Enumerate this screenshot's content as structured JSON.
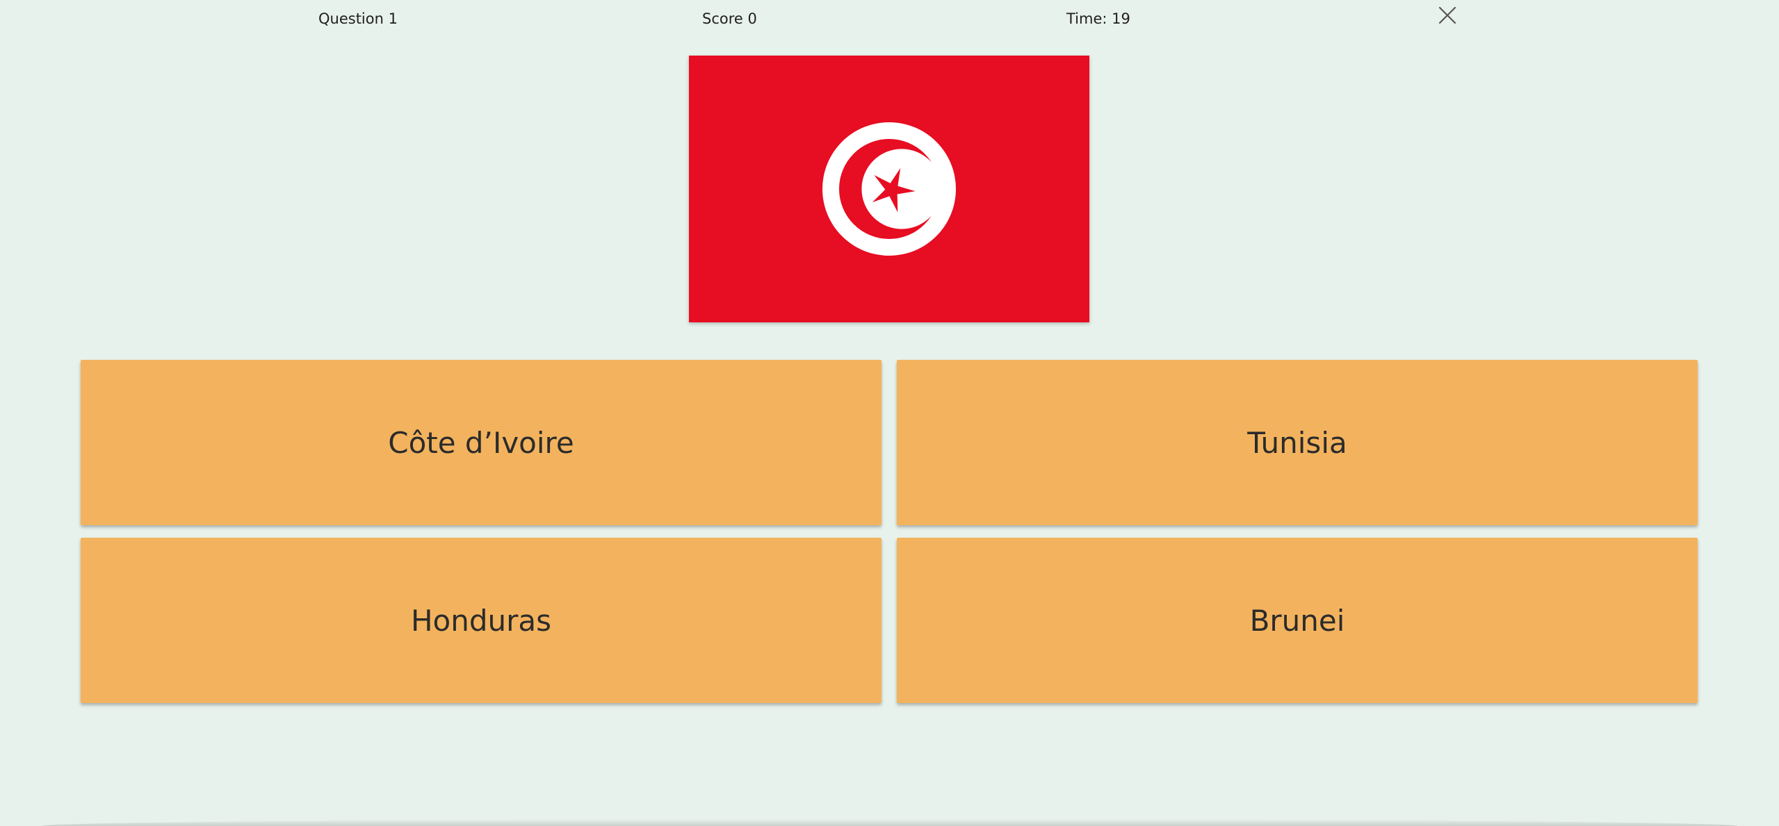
{
  "header": {
    "question": "Question 1",
    "score": "Score 0",
    "timer": "Time: 19",
    "close_icon": "close-icon"
  },
  "flag": {
    "country_shown": "Tunisia",
    "colors": {
      "red": "#e70d22",
      "white": "#ffffff"
    }
  },
  "answers": [
    {
      "label": "Côte d’Ivoire"
    },
    {
      "label": "Tunisia"
    },
    {
      "label": "Honduras"
    },
    {
      "label": "Brunei"
    }
  ],
  "colors": {
    "background": "#e8f2ec",
    "answer_button": "#f3b35e",
    "text": "#2b2b2b"
  }
}
